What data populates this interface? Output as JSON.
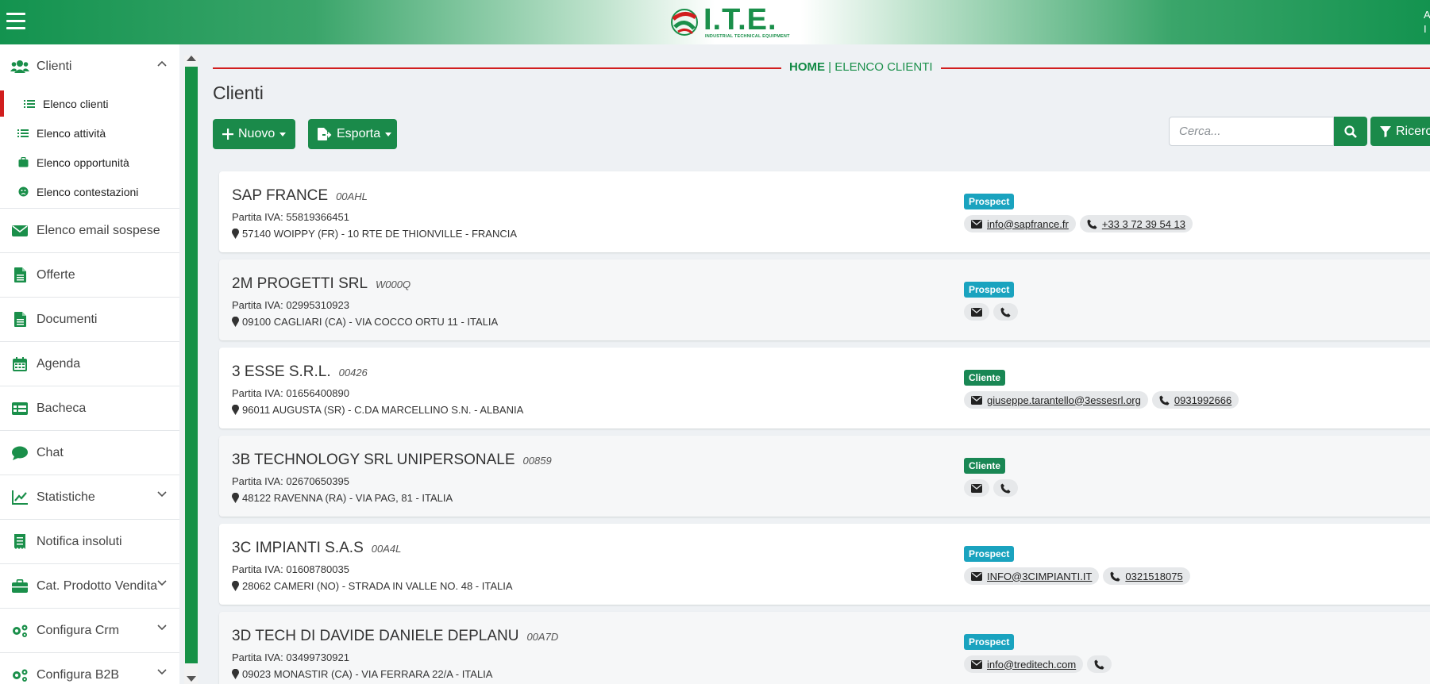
{
  "header": {
    "logo_text": "I.T.E.",
    "logo_sub": "INDUSTRIAL TECHNICAL EQUIPMENT",
    "user_line1": "A",
    "user_line2": "I"
  },
  "sidebar": {
    "clienti": "Clienti",
    "sub": [
      {
        "label": "Elenco clienti"
      },
      {
        "label": "Elenco attività"
      },
      {
        "label": "Elenco opportunità"
      },
      {
        "label": "Elenco contestazioni"
      }
    ],
    "items": [
      {
        "label": "Elenco email sospese",
        "icon": "envelope-icon"
      },
      {
        "label": "Offerte",
        "icon": "file-icon"
      },
      {
        "label": "Documenti",
        "icon": "file-icon"
      },
      {
        "label": "Agenda",
        "icon": "calendar-icon"
      },
      {
        "label": "Bacheca",
        "icon": "table-icon"
      },
      {
        "label": "Chat",
        "icon": "chat-icon"
      },
      {
        "label": "Statistiche",
        "icon": "chart-icon"
      },
      {
        "label": "Notifica insoluti",
        "icon": "receipt-icon"
      },
      {
        "label": "Cat. Prodotto Vendita",
        "icon": "briefcase-icon"
      },
      {
        "label": "Configura Crm",
        "icon": "gears-icon"
      },
      {
        "label": "Configura B2B",
        "icon": "gears-icon"
      }
    ]
  },
  "breadcrumb": {
    "home": "HOME",
    "separator": " | ",
    "current": "ELENCO CLIENTI"
  },
  "page": {
    "title": "Clienti",
    "nuovo_label": "Nuovo",
    "esporta_label": "Esporta",
    "search_placeholder": "Cerca...",
    "filter_label": "Ricerca"
  },
  "clients": [
    {
      "name": "SAP FRANCE",
      "code": "00AHL",
      "piva": "Partita IVA: 55819366451",
      "address": "57140 WOIPPY (FR) - 10 RTE DE THIONVILLE - FRANCIA",
      "status": "Prospect",
      "email": "info@sapfrance.fr",
      "phone": "+33 3 72 39 54 13"
    },
    {
      "name": "2M PROGETTI SRL",
      "code": "W000Q",
      "piva": "Partita IVA: 02995310923",
      "address": "09100 CAGLIARI (CA) - VIA COCCO ORTU 11 - ITALIA",
      "status": "Prospect",
      "email": "",
      "phone": ""
    },
    {
      "name": "3 ESSE S.R.L.",
      "code": "00426",
      "piva": "Partita IVA: 01656400890",
      "address": "96011 AUGUSTA (SR) - C.DA MARCELLINO S.N. - ALBANIA",
      "status": "Cliente",
      "email": "giuseppe.tarantello@3essesrl.org",
      "phone": "0931992666"
    },
    {
      "name": "3B TECHNOLOGY SRL UNIPERSONALE",
      "code": "00859",
      "piva": "Partita IVA: 02670650395",
      "address": "48122 RAVENNA (RA) - VIA PAG, 81 - ITALIA",
      "status": "Cliente",
      "email": "",
      "phone": ""
    },
    {
      "name": "3C IMPIANTI S.A.S",
      "code": "00A4L",
      "piva": "Partita IVA: 01608780035",
      "address": "28062 CAMERI (NO) - STRADA IN VALLE NO. 48 - ITALIA",
      "status": "Prospect",
      "email": "INFO@3CIMPIANTI.IT",
      "phone": "0321518075"
    },
    {
      "name": "3D TECH DI DAVIDE DANIELE DEPLANU",
      "code": "00A7D",
      "piva": "Partita IVA: 03499730921",
      "address": "09023 MONASTIR (CA) - VIA FERRARA 22/A - ITALIA",
      "status": "Prospect",
      "email": "info@treditech.com",
      "phone": ""
    }
  ],
  "colors": {
    "brand_green": "#1a8a4a",
    "accent_red": "#d11e1e",
    "prospect": "#1aa3bf",
    "cliente": "#198754"
  }
}
